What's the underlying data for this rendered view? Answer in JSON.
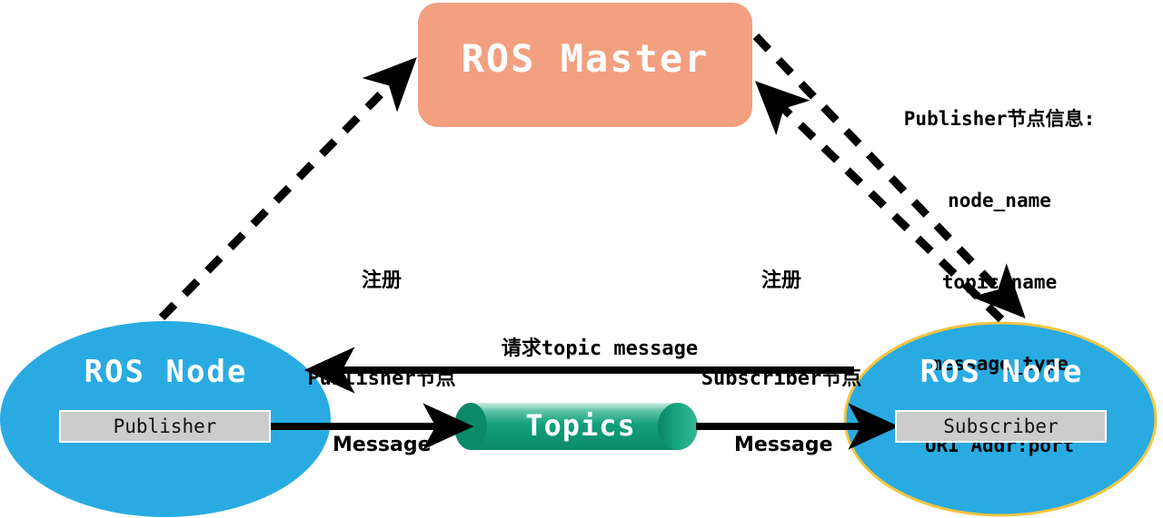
{
  "diagram": {
    "master": {
      "label": "ROS Master",
      "fill": "#f2a080"
    },
    "publisher_node": {
      "title": "ROS Node",
      "role_label": "Publisher",
      "fill": "#29abe2",
      "role_fill": "#cccccc"
    },
    "subscriber_node": {
      "title": "ROS Node",
      "role_label": "Subscriber",
      "fill": "#29abe2",
      "stroke": "#f5c542",
      "role_fill": "#cccccc"
    },
    "topics": {
      "label": "Topics",
      "fill": "#0e9e78",
      "fill_light": "#dff3ec"
    },
    "register_publisher": {
      "line1": "注册",
      "line2": "Publisher节点"
    },
    "register_subscriber": {
      "line1": "注册",
      "line2": "Subscriber节点"
    },
    "publisher_info": {
      "heading": "Publisher节点信息:",
      "items": [
        "node_name",
        "topic_name",
        "message_type",
        "URI Addr:port"
      ]
    },
    "request_label": "请求topic message",
    "message_left": "Message",
    "message_right": "Message"
  }
}
